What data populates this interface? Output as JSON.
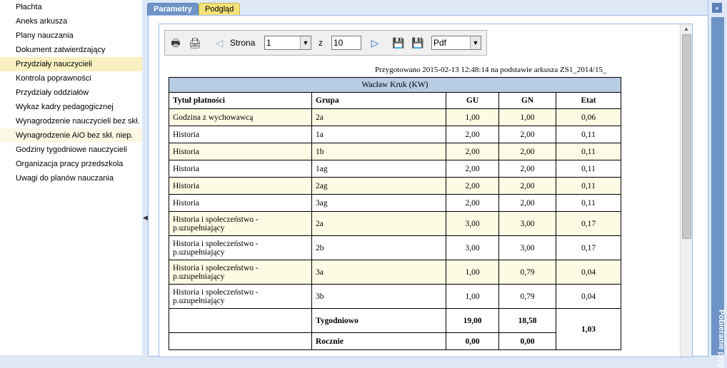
{
  "nav": {
    "items": [
      {
        "label": "Płachta",
        "state": ""
      },
      {
        "label": "Aneks arkusza",
        "state": ""
      },
      {
        "label": "Plany nauczania",
        "state": ""
      },
      {
        "label": "Dokument zatwierdzający",
        "state": ""
      },
      {
        "label": "Przydziały nauczycieli",
        "state": "selected"
      },
      {
        "label": "Kontrola poprawności",
        "state": ""
      },
      {
        "label": "Przydziały oddziałów",
        "state": ""
      },
      {
        "label": "Wykaz kadry pedagogicznej",
        "state": ""
      },
      {
        "label": "Wynagrodzenie nauczycieli bez skł. r",
        "state": ""
      },
      {
        "label": "Wynagrodzenie AiO bez skł. niep.",
        "state": "hover"
      },
      {
        "label": "Godziny tygodniowe nauczycieli",
        "state": ""
      },
      {
        "label": "Organizacja pracy przedszkola",
        "state": ""
      },
      {
        "label": "Uwagi do planów nauczania",
        "state": ""
      }
    ]
  },
  "tabs": {
    "parametry": "Parametry",
    "podglad": "Podgląd"
  },
  "toolbar": {
    "strona_label": "Strona",
    "page": "1",
    "z_label": "z",
    "total_pages": "10",
    "format": "Pdf"
  },
  "report": {
    "prepared": "Przygotowano 2015-02-13 12:48:14 na podstawie arkusza ZS1_2014/15_",
    "teacher": "Wacław Kruk (KW)",
    "headers": [
      "Tytuł płatności",
      "Grupa",
      "GU",
      "GN",
      "Etat"
    ],
    "rows": [
      {
        "tytul": "Godzina z wychowawcą",
        "grupa": "2a",
        "gu": "1,00",
        "gn": "1,00",
        "etat": "0,06"
      },
      {
        "tytul": "Historia",
        "grupa": "1a",
        "gu": "2,00",
        "gn": "2,00",
        "etat": "0,11"
      },
      {
        "tytul": "Historia",
        "grupa": "1b",
        "gu": "2,00",
        "gn": "2,00",
        "etat": "0,11"
      },
      {
        "tytul": "Historia",
        "grupa": "1ag",
        "gu": "2,00",
        "gn": "2,00",
        "etat": "0,11"
      },
      {
        "tytul": "Historia",
        "grupa": "2ag",
        "gu": "2,00",
        "gn": "2,00",
        "etat": "0,11"
      },
      {
        "tytul": "Historia",
        "grupa": "3ag",
        "gu": "2,00",
        "gn": "2,00",
        "etat": "0,11"
      },
      {
        "tytul": "Historia i społeczeństwo - p.uzupełniający",
        "grupa": "2a",
        "gu": "3,00",
        "gn": "3,00",
        "etat": "0,17"
      },
      {
        "tytul": "Historia i społeczeństwo - p.uzupełniający",
        "grupa": "2b",
        "gu": "3,00",
        "gn": "3,00",
        "etat": "0,17"
      },
      {
        "tytul": "Historia i społeczeństwo - p.uzupełniający",
        "grupa": "3a",
        "gu": "1,00",
        "gn": "0,79",
        "etat": "0,04"
      },
      {
        "tytul": "Historia i społeczeństwo - p.uzupełniający",
        "grupa": "3b",
        "gu": "1,00",
        "gn": "0,79",
        "etat": "0,04"
      }
    ],
    "weekly": {
      "label": "Tygodniowo",
      "gu": "19,00",
      "gn": "18,58",
      "etat": "1,03"
    },
    "annual": {
      "label": "Rocznie",
      "gu": "0,00",
      "gn": "0,00"
    }
  },
  "right_panel": {
    "title": "Pobieranie przy"
  }
}
